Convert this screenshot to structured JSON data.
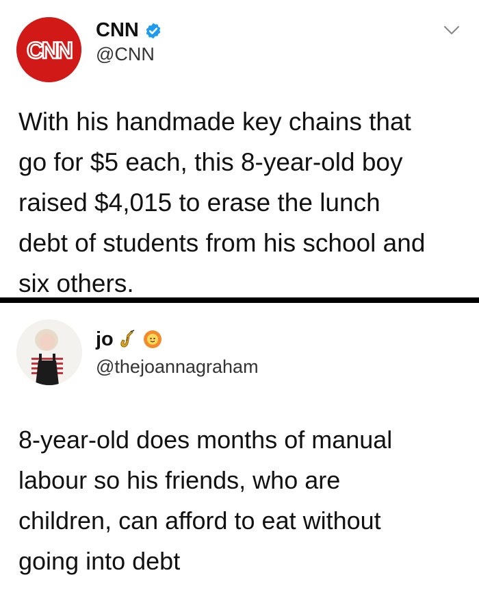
{
  "tweets": [
    {
      "author": {
        "display_name": "CNN",
        "handle": "@CNN",
        "verified": true,
        "avatar_text": "CNN"
      },
      "text": "With his handmade key chains that\ngo for $5 each, this 8-year-old boy\nraised $4,015 to erase the lunch\ndebt of students from his school and\nsix others."
    },
    {
      "author": {
        "display_name": "jo",
        "handle": "@thejoannagraham",
        "name_emojis": [
          "saxophone-icon",
          "sun-face-icon"
        ]
      },
      "text": "8-year-old does months of manual\nlabour so his friends, who are\nchildren, can afford to eat without\ngoing into debt"
    }
  ],
  "colors": {
    "cnn_red": "#d11a18",
    "verified_blue": "#1d9bf0",
    "divider": "#000000"
  }
}
